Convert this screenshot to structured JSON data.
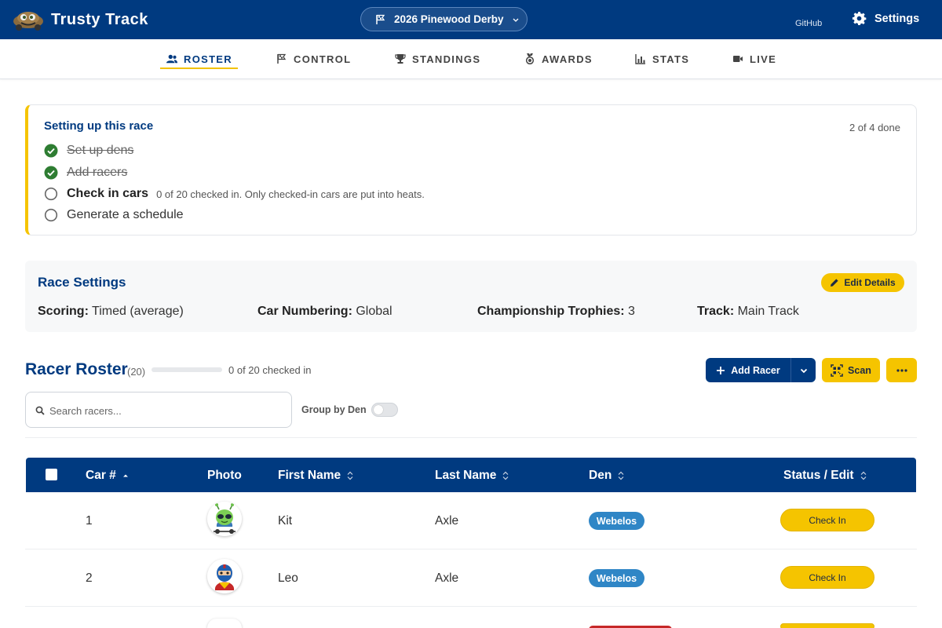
{
  "app": {
    "name": "Trusty Track"
  },
  "header": {
    "race_selector": "2026 Pinewood Derby",
    "github": "GitHub",
    "settings": "Settings"
  },
  "tabs": [
    {
      "label": "ROSTER",
      "icon": "people-icon",
      "active": true
    },
    {
      "label": "CONTROL",
      "icon": "flag-icon",
      "active": false
    },
    {
      "label": "STANDINGS",
      "icon": "trophy-icon",
      "active": false
    },
    {
      "label": "AWARDS",
      "icon": "medal-icon",
      "active": false
    },
    {
      "label": "STATS",
      "icon": "bar-chart-icon",
      "active": false
    },
    {
      "label": "LIVE",
      "icon": "video-camera-icon",
      "active": false
    }
  ],
  "setup": {
    "title": "Setting up this race",
    "progress": "2 of 4 done",
    "steps": [
      {
        "label": "Set up dens",
        "done": true,
        "note": ""
      },
      {
        "label": "Add racers",
        "done": true,
        "note": ""
      },
      {
        "label": "Check in cars",
        "done": false,
        "note": "0 of 20 checked in. Only checked-in cars are put into heats."
      },
      {
        "label": "Generate a schedule",
        "done": false,
        "note": ""
      }
    ]
  },
  "race_settings": {
    "title": "Race Settings",
    "edit_label": "Edit Details",
    "items": [
      {
        "key": "Scoring:",
        "value": "Timed (average)"
      },
      {
        "key": "Car Numbering:",
        "value": "Global"
      },
      {
        "key": "Championship Trophies:",
        "value": "3"
      },
      {
        "key": "Track:",
        "value": "Main Track"
      }
    ]
  },
  "roster": {
    "title": "Racer Roster",
    "count": "(20)",
    "checked_in_fraction": 0,
    "checked_summary": "0 of 20 checked in",
    "add_label": "Add Racer",
    "scan_label": "Scan",
    "search_placeholder": "Search racers...",
    "group_by_label": "Group by Den",
    "group_by_enabled": false
  },
  "table": {
    "columns": [
      "Car #",
      "Photo",
      "First Name",
      "Last Name",
      "Den",
      "Status / Edit"
    ],
    "rows": [
      {
        "car": "1",
        "first": "Kit",
        "last": "Axle",
        "den": "Webelos",
        "den_color": "#2f86c6",
        "action": "Check In",
        "avatar": "alien-avatar"
      },
      {
        "car": "2",
        "first": "Leo",
        "last": "Axle",
        "den": "Webelos",
        "den_color": "#2f86c6",
        "action": "Check In",
        "avatar": "superhero-avatar"
      }
    ]
  },
  "colors": {
    "primary": "#003a80",
    "accent": "#f5c400",
    "success": "#2e7d32",
    "den_webelos": "#2f86c6"
  }
}
